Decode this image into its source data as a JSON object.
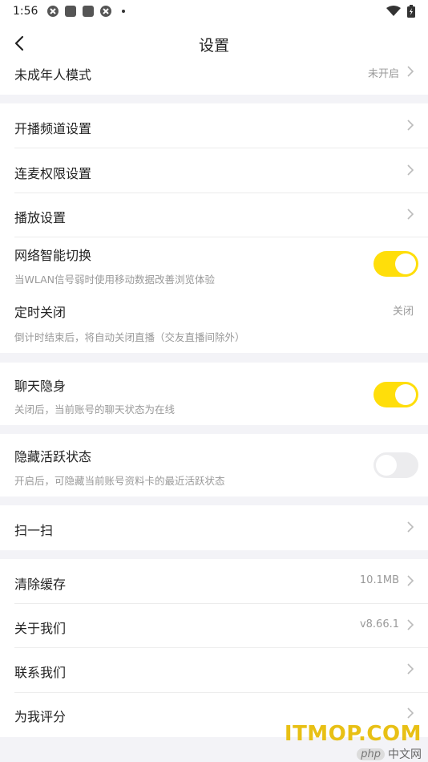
{
  "status_bar": {
    "time": "1:56"
  },
  "header": {
    "title": "设置"
  },
  "sections": {
    "minor": {
      "label": "未成年人模式",
      "value": "未开启"
    },
    "channel": {
      "label": "开播频道设置"
    },
    "mic": {
      "label": "连麦权限设置"
    },
    "playback": {
      "label": "播放设置"
    },
    "network": {
      "label": "网络智能切换",
      "desc": "当WLAN信号弱时使用移动数据改善浏览体验",
      "enabled": true
    },
    "timer": {
      "label": "定时关闭",
      "value": "关闭",
      "desc": "倒计时结束后，将自动关闭直播（交友直播间除外）"
    },
    "invisible": {
      "label": "聊天隐身",
      "desc": "关闭后，当前账号的聊天状态为在线",
      "enabled": true
    },
    "hide_active": {
      "label": "隐藏活跃状态",
      "desc": "开启后，可隐藏当前账号资料卡的最近活跃状态",
      "enabled": false
    },
    "scan": {
      "label": "扫一扫"
    },
    "cache": {
      "label": "清除缓存",
      "value": "10.1MB"
    },
    "about": {
      "label": "关于我们",
      "value": "v8.66.1"
    },
    "contact": {
      "label": "联系我们"
    },
    "rate": {
      "label": "为我评分"
    }
  },
  "watermark": {
    "main": "ITMOP.COM",
    "badge": "php",
    "cn": "中文网"
  },
  "colors": {
    "toggle_on": "#ffde0a",
    "toggle_off": "#ececee",
    "background": "#f3f3f7"
  }
}
